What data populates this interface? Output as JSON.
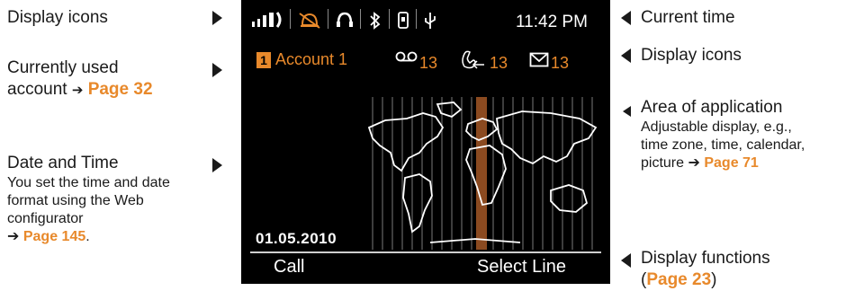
{
  "labels": {
    "display_icons_left": "Display icons",
    "used_account_line1": "Currently used",
    "used_account_line2": "account",
    "used_account_page": "Page 32",
    "date_time_title": "Date and Time",
    "date_time_line1": "You set the time and date",
    "date_time_line2": "format using the Web",
    "date_time_line3": "configurator",
    "date_time_page": "Page 145",
    "date_time_period": ".",
    "current_time": "Current time",
    "display_icons_right": "Display icons",
    "area_title": "Area of application",
    "area_line1": "Adjustable display, e.g.,",
    "area_line2": "time zone, time, calendar,",
    "area_line3": "picture",
    "area_page": "Page 71",
    "functions_title": "Display functions",
    "functions_open": "(",
    "functions_page": "Page 23",
    "functions_close": ")",
    "ref_arrow": "➔"
  },
  "screen": {
    "time": "11:42 PM",
    "account_number": "1",
    "account_name": "Account 1",
    "voicemail_count": "13",
    "missed_calls_count": "13",
    "messages_count": "13",
    "date": "01.05.2010",
    "softkey_left": "Call",
    "softkey_right": "Select Line",
    "icons": [
      "signal-strength-icon",
      "ringer-off-icon",
      "headset-icon",
      "bluetooth-icon",
      "handset-icon",
      "usb-icon",
      "voicemail-icon",
      "missed-call-icon",
      "message-icon",
      "world-map-icon"
    ]
  },
  "colors": {
    "accent": "#e8892b",
    "screen_bg": "#000000",
    "time_zone_band": "#8b4a20"
  }
}
